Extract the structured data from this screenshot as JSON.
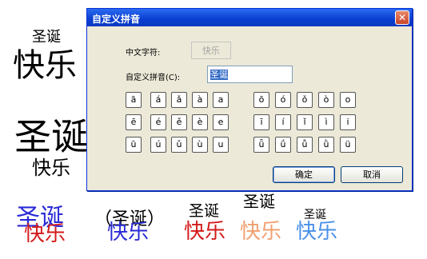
{
  "dialog": {
    "title": "自定义拼音",
    "close_label": "✕",
    "chinese_label": "中文字符:",
    "chinese_value": "快乐",
    "pinyin_label": "自定义拼音(C):",
    "pinyin_value": "圣诞",
    "left_keys": [
      [
        "ā",
        "á",
        "ǎ",
        "à",
        "a"
      ],
      [
        "ē",
        "é",
        "ě",
        "è",
        "e"
      ],
      [
        "ū",
        "ú",
        "ǔ",
        "ù",
        "u"
      ]
    ],
    "right_keys": [
      [
        "ō",
        "ó",
        "ǒ",
        "ò",
        "o"
      ],
      [
        "ī",
        "í",
        "ǐ",
        "ì",
        "i"
      ],
      [
        "ǖ",
        "ǘ",
        "ǚ",
        "ǜ",
        "ü"
      ]
    ],
    "ok_label": "确定",
    "cancel_label": "取消"
  },
  "document": {
    "sample1_ruby": "圣诞",
    "sample1_base": "快乐",
    "sample2_base": "圣诞",
    "sample2_ruby": "快乐",
    "row": {
      "s1_top": "圣诞",
      "s1_bottom": "快乐",
      "s2_paren": "（圣诞）",
      "s2_base": "快乐",
      "s3_ruby": "圣诞",
      "s3_base": "快乐",
      "s4_ruby": "圣诞",
      "s4_base": "快乐",
      "s5_ruby": "圣诞",
      "s5_base": "快乐"
    }
  },
  "colors": {
    "title_bar": "#0a3ed0",
    "blue_text": "#2b2bd6",
    "red_text": "#d41a1a",
    "orange_text": "#f0a070",
    "light_blue_text": "#4a90e8"
  }
}
